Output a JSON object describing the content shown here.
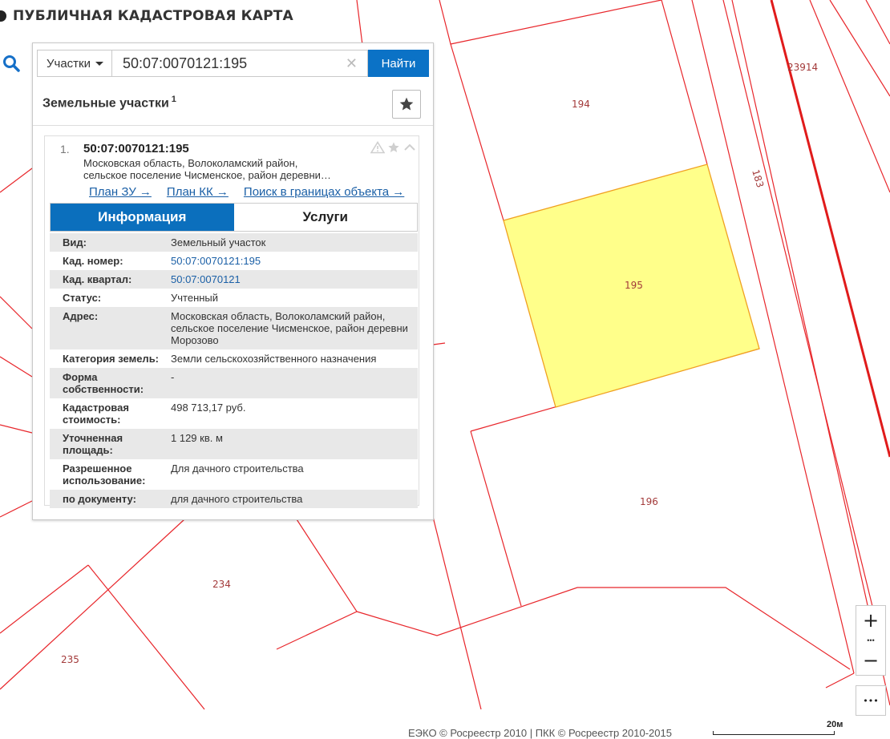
{
  "header": {
    "title": "ПУБЛИЧНАЯ КАДАСТРОВАЯ КАРТА"
  },
  "search": {
    "type_label": "Участки",
    "query": "50:07:0070121:195",
    "find_label": "Найти"
  },
  "results": {
    "section_title": "Земельные участки",
    "count": "1",
    "item": {
      "index": "1.",
      "cad_number": "50:07:0070121:195",
      "address_line1": "Московская область, Волоколамский район,",
      "address_line2": "сельское поселение Чисменское, район деревни…",
      "links": [
        "План ЗУ →",
        "План КК →",
        "Поиск в границах объекта →"
      ],
      "tabs": [
        "Информация",
        "Услуги"
      ]
    }
  },
  "info": [
    {
      "key": "Вид:",
      "value": "Земельный участок"
    },
    {
      "key": "Кад. номер:",
      "value": "50:07:0070121:195"
    },
    {
      "key": "Кад. квартал:",
      "value": "50:07:0070121"
    },
    {
      "key": "Статус:",
      "value": "Учтенный"
    },
    {
      "key": "Адрес:",
      "value": "Московская область, Волоколамский район, сельское поселение Чисменское, район деревни Морозово"
    },
    {
      "key": "Категория земель:",
      "value": "Земли сельскохозяйственного назначения"
    },
    {
      "key": "Форма собственности:",
      "value": "-"
    },
    {
      "key": "Кадастровая стоимость:",
      "value": "498 713,17 руб."
    },
    {
      "key": "Уточненная площадь:",
      "value": "1 129 кв. м"
    },
    {
      "key": "Разрешенное использование:",
      "value": "Для дачного строительства"
    },
    {
      "key": "по документу:",
      "value": "для дачного строительства"
    }
  ],
  "map": {
    "parcel_labels": {
      "p194": "194",
      "p195": "195",
      "p196": "196",
      "p183": "183",
      "p23914": "23914",
      "p234": "234",
      "p235": "235"
    },
    "selected_fill": "#ffff8a",
    "boundary_color": "#e8262b"
  },
  "controls": {
    "zoom_in": "+",
    "zoom_out": "−",
    "more": "•••"
  },
  "footer": {
    "attribution": "ЕЭКО © Росреестр 2010 | ПКК © Росреестр 2010-2015",
    "scale_label": "20м"
  }
}
